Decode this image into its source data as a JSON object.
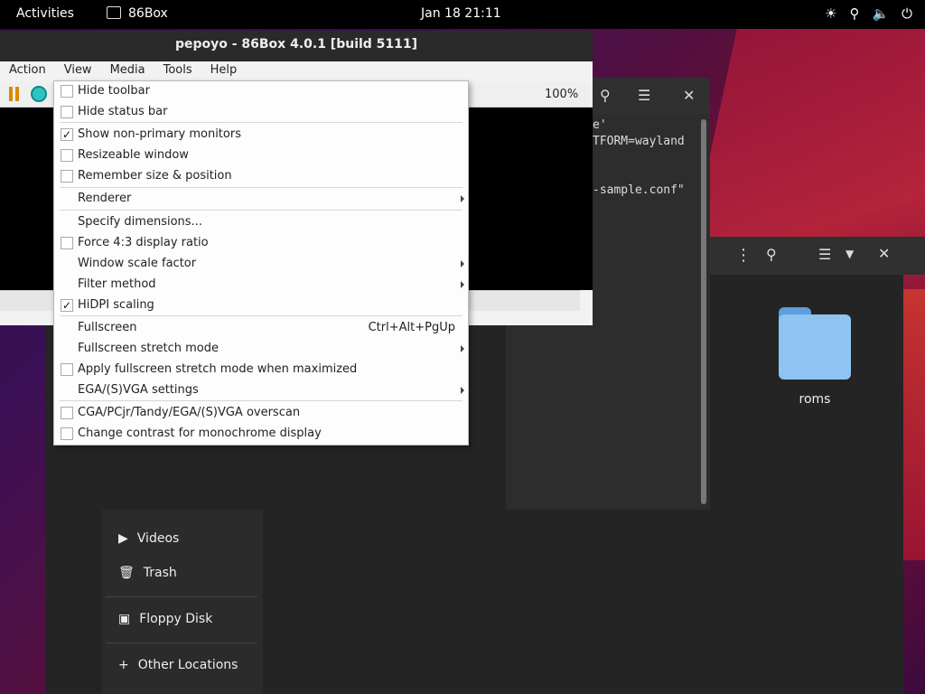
{
  "topbar": {
    "activities": "Activities",
    "app_name": "86Box",
    "clock": "Jan 18  21:11",
    "tray": [
      "brightness-icon",
      "network-icon",
      "volume-icon",
      "power-icon"
    ]
  },
  "box_window": {
    "title": "pepoyo - 86Box 4.0.1 [build 5111]",
    "menus": [
      "Action",
      "View",
      "Media",
      "Tools",
      "Help"
    ],
    "zoom": "100%"
  },
  "view_menu": {
    "items": [
      {
        "label": "Hide toolbar",
        "checkbox": true,
        "checked": false
      },
      {
        "label": "Hide status bar",
        "checkbox": true,
        "checked": false
      },
      {
        "label": "Show non-primary monitors",
        "checkbox": true,
        "checked": true
      },
      {
        "label": "Resizeable window",
        "checkbox": true,
        "checked": false
      },
      {
        "label": "Remember size & position",
        "checkbox": true,
        "checked": false
      },
      {
        "label": "Renderer",
        "submenu": true
      },
      {
        "label": "Specify dimensions...",
        "checkbox": false
      },
      {
        "label": "Force 4:3 display ratio",
        "checkbox": true,
        "checked": false
      },
      {
        "label": "Window scale factor",
        "submenu": true
      },
      {
        "label": "Filter method",
        "submenu": true
      },
      {
        "label": "HiDPI scaling",
        "checkbox": true,
        "checked": true
      },
      {
        "label": "Fullscreen",
        "shortcut": "Ctrl+Alt+PgUp"
      },
      {
        "label": "Fullscreen stretch mode",
        "submenu": true
      },
      {
        "label": "Apply fullscreen stretch mode when maximized",
        "checkbox": true,
        "checked": false
      },
      {
        "label": "EGA/(S)VGA settings",
        "submenu": true
      },
      {
        "label": "CGA/PCjr/Tandy/EGA/(S)VGA overscan",
        "checkbox": true,
        "checked": false
      },
      {
        "label": "Change contrast for monochrome display",
        "checkbox": true,
        "checked": false
      }
    ]
  },
  "terminal": {
    "lines": [
      "e'",
      "TFORM=wayland",
      "",
      "",
      "-sample.conf\""
    ]
  },
  "files": {
    "folder_name": "roms",
    "sidebar": [
      "Videos",
      "Trash",
      "Floppy Disk",
      "Other Locations"
    ]
  }
}
